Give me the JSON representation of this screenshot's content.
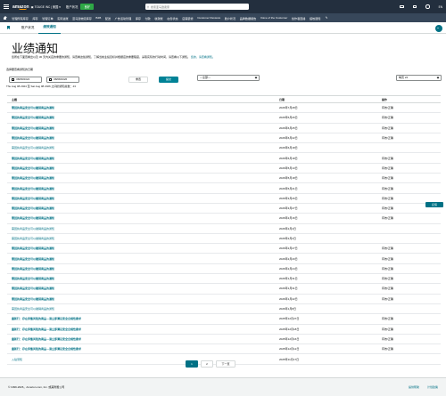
{
  "topbar": {
    "logo": "amazon",
    "store_selector": "TOUGE INC | 美国",
    "account_label": "账户状况",
    "status_pill": "良好",
    "search_placeholder": "搜索亚马逊卖家",
    "language": "EN"
  },
  "nav": {
    "items": [
      "管理所有库存",
      "库存",
      "管理订单",
      "实际进账",
      "亚马逊物流库存",
      "B2B",
      "配送",
      "广告活动管理",
      "库存",
      "付款",
      "收款账",
      "在售状态",
      "店铺装修",
      "Customer Reviews",
      "账户状况",
      "品牌数据报告",
      "Voice of the Customer",
      "创作者直播",
      "绩效通知"
    ]
  },
  "tabs": {
    "items": [
      {
        "label": "账户状况",
        "active": false
      },
      {
        "label": "绩效通知",
        "active": true
      }
    ]
  },
  "page": {
    "title": "业绩通知",
    "description_text": "您所在下面查看出以及 30 天内关店的重要的通知，请查看这些通知，了解当前业绩目标并根据店的重要程度，采取实际的行动时间，请查看以下通知。",
    "description_link": "您的，请查看通知。",
    "range_label": "选择要查看通知的日期",
    "date_from": "08/08/2024",
    "date_to": "08/08/2026",
    "reset_label": "重置",
    "apply_label": "提交",
    "filter_select": "—全部—",
    "per_page_select": "每页 24",
    "range_text": "Thu Aug 08 2024 至 Sat Aug 08 2026 之间的通知总数：43",
    "side_button": "反馈"
  },
  "table": {
    "headers": {
      "subject": "主题",
      "date": "日期",
      "action": "操作"
    },
    "rows": [
      {
        "subject": "需回执商品安全可以撤销商品的通知",
        "date": "2026年7月28日",
        "action": "有效/正确",
        "read": false
      },
      {
        "subject": "需回执商品安全可以撤销商品的通知",
        "date": "2026年6月26日",
        "action": "有效/正确",
        "read": false
      },
      {
        "subject": "需回执商品安全可以撤销商品的通知",
        "date": "2026年6月25日",
        "action": "有效/正确",
        "read": false
      },
      {
        "subject": "需回执商品安全可以撤销商品的通知",
        "date": "2026年6月22日",
        "action": "有效/正确",
        "read": false
      },
      {
        "subject": "需回执商品安全可以撤销商品的通知",
        "date": "2026年6月18日",
        "action": "",
        "read": true
      },
      {
        "subject": "需回执商品安全可以撤销商品的通知",
        "date": "2026年6月18日",
        "action": "有效/正确",
        "read": false
      },
      {
        "subject": "需回执商品安全可以撤销商品的通知",
        "date": "2026年5月13日",
        "action": "有效/正确",
        "read": false
      },
      {
        "subject": "需回执商品安全可以撤销商品的通知",
        "date": "2026年5月18日",
        "action": "有效/正确",
        "read": false
      },
      {
        "subject": "需回执商品安全可以撤销商品的通知",
        "date": "2026年5月21日",
        "action": "有效/正确",
        "read": false
      },
      {
        "subject": "需回执商品安全可以撤销商品的通知",
        "date": "2026年3月26日",
        "action": "有效/正确",
        "read": false
      },
      {
        "subject": "需回执商品安全可以撤销商品的通知",
        "date": "2026年3月27日",
        "action": "有效/正确",
        "read": false
      },
      {
        "subject": "需回执商品安全可以撤销商品的通知",
        "date": "2026年2月16日",
        "action": "有效/正确",
        "read": false
      },
      {
        "subject": "需回执商品安全可以撤销商品的通知",
        "date": "2026年2月4日",
        "action": "",
        "read": true
      },
      {
        "subject": "需回执商品安全可以撤销商品的通知",
        "date": "2026年2月2日",
        "action": "",
        "read": true
      },
      {
        "subject": "需回执商品安全可以撤销商品的通知",
        "date": "2026年2月27日",
        "action": "有效/正确",
        "read": false
      },
      {
        "subject": "需回执商品安全可以撤销商品的通知",
        "date": "2026年2月20日",
        "action": "有效/正确",
        "read": false
      },
      {
        "subject": "需回执商品安全可以撤销商品的通知",
        "date": "2026年2月24日",
        "action": "有效/正确",
        "read": false
      },
      {
        "subject": "需回执商品安全可以撤销商品的通知",
        "date": "2026年1月31日",
        "action": "有效/正确",
        "read": false
      },
      {
        "subject": "需回执商品安全可以撤销商品的通知",
        "date": "2026年1月31日",
        "action": "有效/正确",
        "read": false
      },
      {
        "subject": "需回执商品安全可以撤销商品的通知",
        "date": "2026年1月22日",
        "action": "有效/正确",
        "read": false
      },
      {
        "subject": "需回执商品安全可以撤销商品的通知",
        "date": "2026年1月8日",
        "action": "",
        "read": true
      },
      {
        "subject": "重新行：存在停售风险的商品—请立即满足安全合规性要求",
        "date": "2025年12月27日",
        "action": "有效/正确",
        "read": false
      },
      {
        "subject": "重新行：存在停售风险的商品—请立即满足安全合规性要求",
        "date": "2025年12月18日",
        "action": "有效/正确",
        "read": false
      },
      {
        "subject": "重新行：存在停售风险的商品—请立即满足安全合规性要求",
        "date": "2025年12月16日",
        "action": "有效/正确",
        "read": false
      },
      {
        "subject": "重新行：存在停售风险的商品—请立即满足安全合规性要求",
        "date": "2025年12月12日",
        "action": "有效/正确",
        "read": false
      },
      {
        "subject": "入驻须知",
        "date": "2025年11月17日",
        "action": "",
        "read": true
      }
    ]
  },
  "pagination": {
    "pages": [
      "1",
      "2"
    ],
    "active": "1",
    "next_label": "下一页"
  },
  "footer": {
    "copyright": "© 1999-2026，Amazon.com, Inc. 或其附属公司",
    "links": [
      "提供帮助",
      "计划政策"
    ]
  }
}
